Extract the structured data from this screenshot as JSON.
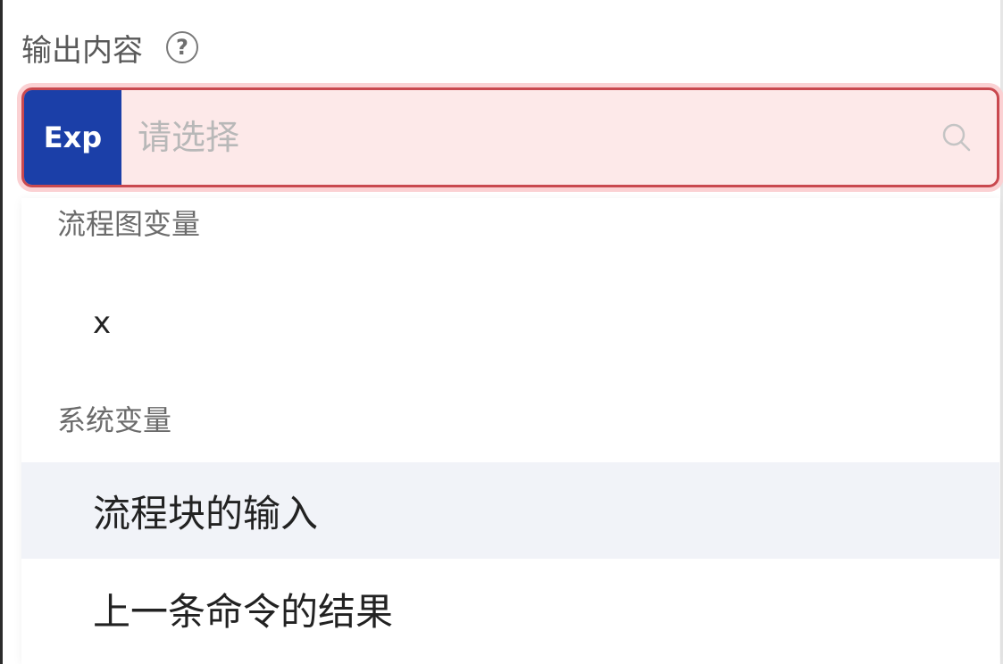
{
  "field": {
    "label": "输出内容",
    "help_icon": "question-circle-icon"
  },
  "select": {
    "tag": "Exp",
    "placeholder": "请选择",
    "search_icon": "search-icon",
    "state": "error",
    "colors": {
      "tag_bg": "#1b3fa8",
      "border": "#c9494f",
      "background": "#fde9e9"
    }
  },
  "dropdown": {
    "groups": [
      {
        "label": "流程图变量",
        "options": [
          {
            "label": "x"
          }
        ]
      },
      {
        "label": "系统变量",
        "options": [
          {
            "label": "流程块的输入",
            "hovered": true
          },
          {
            "label": "上一条命令的结果"
          }
        ]
      }
    ]
  }
}
